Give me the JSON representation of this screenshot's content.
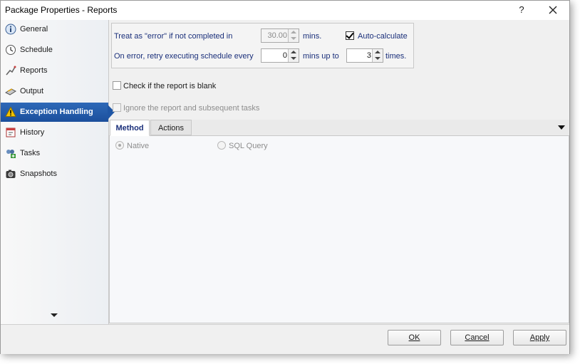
{
  "window": {
    "title": "Package Properties - Reports",
    "help_label": "?"
  },
  "sidebar": {
    "items": [
      {
        "label": "General",
        "icon": "info-icon"
      },
      {
        "label": "Schedule",
        "icon": "clock-icon"
      },
      {
        "label": "Reports",
        "icon": "reports-icon"
      },
      {
        "label": "Output",
        "icon": "output-icon"
      },
      {
        "label": "Exception Handling",
        "icon": "warning-icon",
        "active": true
      },
      {
        "label": "History",
        "icon": "history-icon"
      },
      {
        "label": "Tasks",
        "icon": "tasks-icon"
      },
      {
        "label": "Snapshots",
        "icon": "camera-icon"
      }
    ]
  },
  "exception": {
    "treat_error_label": "Treat as \"error\" if not completed in",
    "treat_error_value": "30.00",
    "mins_label": "mins.",
    "auto_calculate_label": "Auto-calculate",
    "auto_calculate_checked": true,
    "retry_label": "On error, retry  executing schedule every",
    "retry_value": "0",
    "mins_up_to_label": "mins up to",
    "times_value": "3",
    "times_label": "times.",
    "blank_check_label": "Check if the report is blank",
    "ignore_label": "Ignore the report and subsequent tasks"
  },
  "tabs": [
    {
      "label": "Method",
      "active": true
    },
    {
      "label": "Actions"
    }
  ],
  "method": {
    "option_native": "Native",
    "option_sql": "SQL Query",
    "selected": "Native"
  },
  "footer": {
    "ok_label": "OK",
    "cancel_label": "Cancel",
    "apply_label": "Apply"
  },
  "colors": {
    "accent": "#2e69b8",
    "label_blue": "#1a2f7a",
    "warning": "#f3c400"
  }
}
